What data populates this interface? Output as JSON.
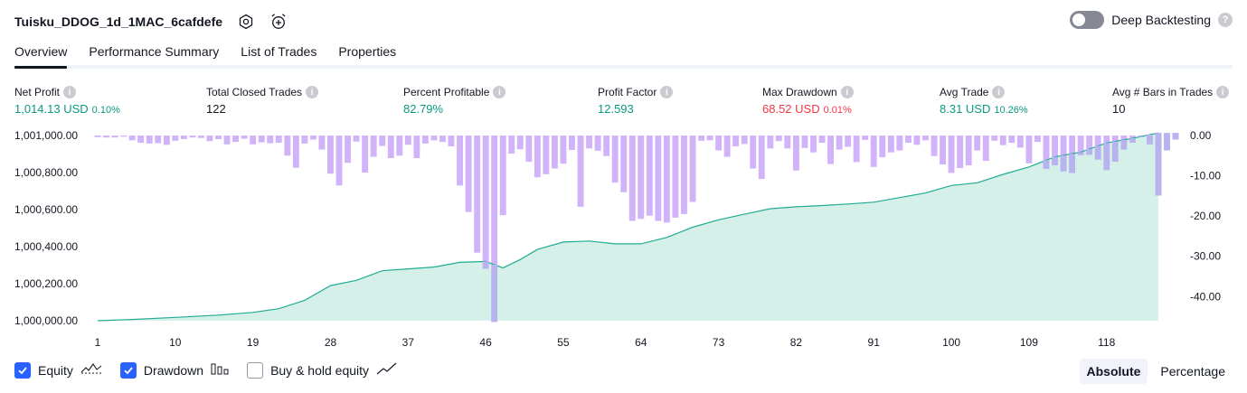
{
  "header": {
    "title": "Tuisku_DDOG_1d_1MAC_6cafdefe",
    "deep_backtesting_label": "Deep Backtesting",
    "help_glyph": "?"
  },
  "tabs": [
    {
      "label": "Overview",
      "active": true
    },
    {
      "label": "Performance Summary",
      "active": false
    },
    {
      "label": "List of Trades",
      "active": false
    },
    {
      "label": "Properties",
      "active": false
    }
  ],
  "metrics": {
    "info_glyph": "i",
    "net_profit": {
      "label": "Net Profit",
      "value": "1,014.13 USD",
      "pct": "0.10%"
    },
    "total_closed_trades": {
      "label": "Total Closed Trades",
      "value": "122"
    },
    "percent_profitable": {
      "label": "Percent Profitable",
      "value": "82.79%"
    },
    "profit_factor": {
      "label": "Profit Factor",
      "value": "12.593"
    },
    "max_drawdown": {
      "label": "Max Drawdown",
      "value": "68.52 USD",
      "pct": "0.01%"
    },
    "avg_trade": {
      "label": "Avg Trade",
      "value": "8.31 USD",
      "pct": "10.26%"
    },
    "avg_bars": {
      "label": "Avg # Bars in Trades",
      "value": "10"
    }
  },
  "legend": {
    "equity": {
      "label": "Equity",
      "checked": true
    },
    "drawdown": {
      "label": "Drawdown",
      "checked": true
    },
    "buy_hold": {
      "label": "Buy & hold equity",
      "checked": false
    }
  },
  "mode": {
    "absolute": "Absolute",
    "percentage": "Percentage",
    "selected": "Absolute"
  },
  "colors": {
    "equity_line": "#22ab94",
    "equity_fill": "#d5f0e9",
    "drawdown_bar": "#d1b3fa",
    "drawdown_bar_overlap": "#b8b3ee",
    "profit_green": "#089981",
    "loss_red": "#f23645",
    "accent_blue": "#2962ff"
  },
  "chart_data": {
    "type": "area",
    "x_ticks": [
      "1",
      "10",
      "19",
      "28",
      "37",
      "46",
      "55",
      "64",
      "73",
      "82",
      "91",
      "100",
      "109",
      "118"
    ],
    "y_left_ticks": [
      "1,001,000.00",
      "1,000,800.00",
      "1,000,600.00",
      "1,000,400.00",
      "1,000,200.00",
      "1,000,000.00"
    ],
    "y_left_range": [
      1000000,
      1001000
    ],
    "y_right_ticks": [
      "0.00",
      "-10.00",
      "-20.00",
      "-30.00",
      "-40.00"
    ],
    "y_right_range": [
      -46,
      0
    ],
    "equity": [
      [
        1,
        1000000
      ],
      [
        5,
        1000007
      ],
      [
        10,
        1000018
      ],
      [
        15,
        1000030
      ],
      [
        19,
        1000045
      ],
      [
        22,
        1000065
      ],
      [
        25,
        1000110
      ],
      [
        28,
        1000190
      ],
      [
        31,
        1000218
      ],
      [
        34,
        1000270
      ],
      [
        37,
        1000280
      ],
      [
        40,
        1000290
      ],
      [
        43,
        1000315
      ],
      [
        46,
        1000320
      ],
      [
        48,
        1000285
      ],
      [
        50,
        1000330
      ],
      [
        52,
        1000385
      ],
      [
        55,
        1000425
      ],
      [
        58,
        1000430
      ],
      [
        61,
        1000415
      ],
      [
        64,
        1000415
      ],
      [
        67,
        1000450
      ],
      [
        70,
        1000505
      ],
      [
        73,
        1000545
      ],
      [
        76,
        1000575
      ],
      [
        79,
        1000605
      ],
      [
        82,
        1000615
      ],
      [
        85,
        1000622
      ],
      [
        88,
        1000630
      ],
      [
        91,
        1000640
      ],
      [
        94,
        1000665
      ],
      [
        97,
        1000690
      ],
      [
        100,
        1000730
      ],
      [
        103,
        1000745
      ],
      [
        106,
        1000790
      ],
      [
        109,
        1000830
      ],
      [
        112,
        1000885
      ],
      [
        115,
        1000910
      ],
      [
        118,
        1000960
      ],
      [
        121,
        1000985
      ],
      [
        124,
        1001014
      ]
    ],
    "drawdown": [
      -0.4,
      -0.5,
      -0.5,
      -0.3,
      -1.2,
      -1.8,
      -2.0,
      -1.9,
      -2.3,
      -1.3,
      -0.9,
      -0.5,
      -0.6,
      -1.4,
      -0.9,
      -2.2,
      -1.6,
      -0.8,
      -2.2,
      -1.7,
      -1.9,
      -1.8,
      -5.0,
      -8.0,
      -2.0,
      -1.0,
      -3.5,
      -9.5,
      -12.4,
      -6.8,
      -1.5,
      -9.2,
      -5.3,
      -2.6,
      -5.6,
      -5.0,
      -2.3,
      -5.6,
      -2.0,
      -1.2,
      -1.6,
      -2.7,
      -12.4,
      -19.0,
      -29.1,
      -33.1,
      -46.3,
      -19.8,
      -4.5,
      -3.4,
      -6.5,
      -10.4,
      -9.6,
      -8.2,
      -7.0,
      -3.6,
      -17.7,
      -3.2,
      -3.8,
      -5.1,
      -11.7,
      -14.1,
      -21.2,
      -20.7,
      -19.9,
      -21.2,
      -21.6,
      -20.4,
      -19.5,
      -16.5,
      -1.3,
      -1.2,
      -3.7,
      -5.3,
      -2.7,
      -2.1,
      -8.2,
      -10.8,
      -3.2,
      -1.4,
      -3.2,
      -8.7,
      -3.1,
      -4.2,
      -1.8,
      -7.1,
      -3.5,
      -2.8,
      -6.6,
      -1.1,
      -7.8,
      -5.4,
      -4.2,
      -3.7,
      -1.8,
      -2.3,
      -1.2,
      -5.1,
      -7.2,
      -9.3,
      -8.1,
      -7.4,
      -3.7,
      -6.3,
      -1.3,
      -2.4,
      -1.8,
      -3.0,
      -6.9,
      -1.6,
      -8.3,
      -7.4,
      -8.9,
      -9.3,
      -4.9,
      -4.8,
      -6.0,
      -8.6,
      -6.5,
      -3.5,
      -1.8,
      -0.4,
      -2.2,
      -14.9,
      -3.7,
      -1.0
    ]
  }
}
